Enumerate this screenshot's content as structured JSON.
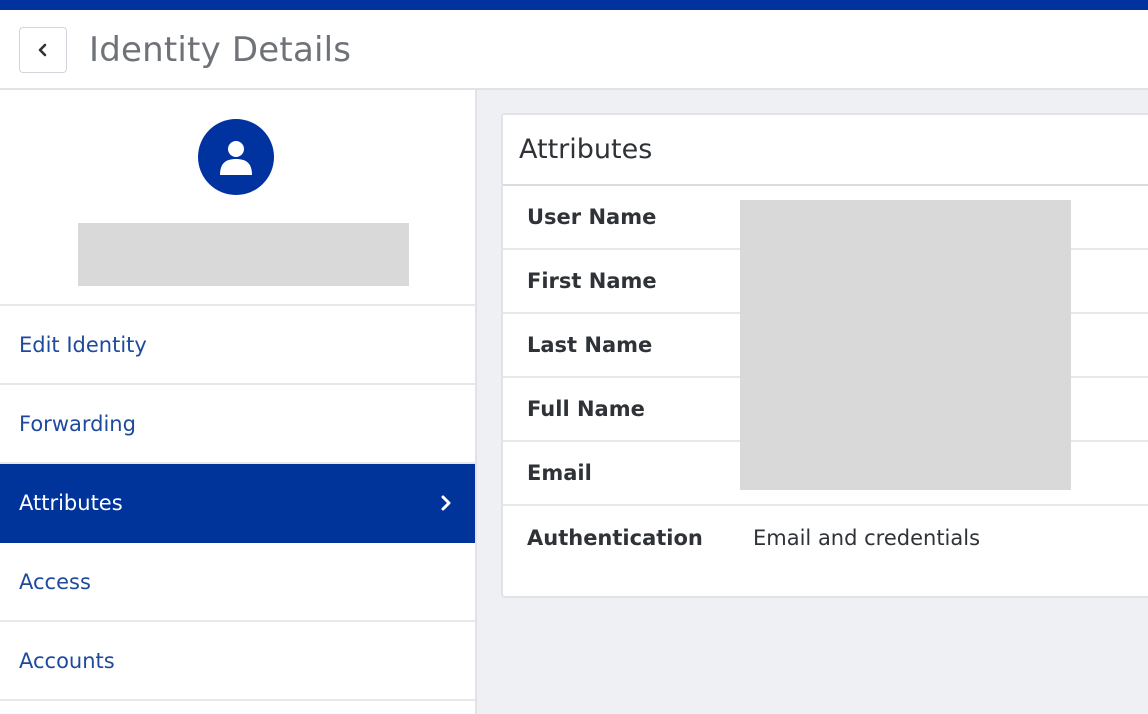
{
  "header": {
    "title": "Identity Details",
    "back_icon": "chevron-left-icon"
  },
  "sidebar": {
    "avatar_icon": "user-icon",
    "items": [
      {
        "label": "Edit Identity",
        "active": false
      },
      {
        "label": "Forwarding",
        "active": false
      },
      {
        "label": "Attributes",
        "active": true
      },
      {
        "label": "Access",
        "active": false
      },
      {
        "label": "Accounts",
        "active": false
      }
    ]
  },
  "card": {
    "title": "Attributes",
    "rows": [
      {
        "label": "User Name",
        "value": ""
      },
      {
        "label": "First Name",
        "value": ""
      },
      {
        "label": "Last Name",
        "value": ""
      },
      {
        "label": "Full Name",
        "value": ""
      },
      {
        "label": "Email",
        "value": ""
      },
      {
        "label": "Authentication",
        "value": "Email and credentials"
      }
    ]
  },
  "colors": {
    "brand": "#0033a0",
    "link": "#1e4a9e",
    "page_bg": "#eef0f3"
  }
}
